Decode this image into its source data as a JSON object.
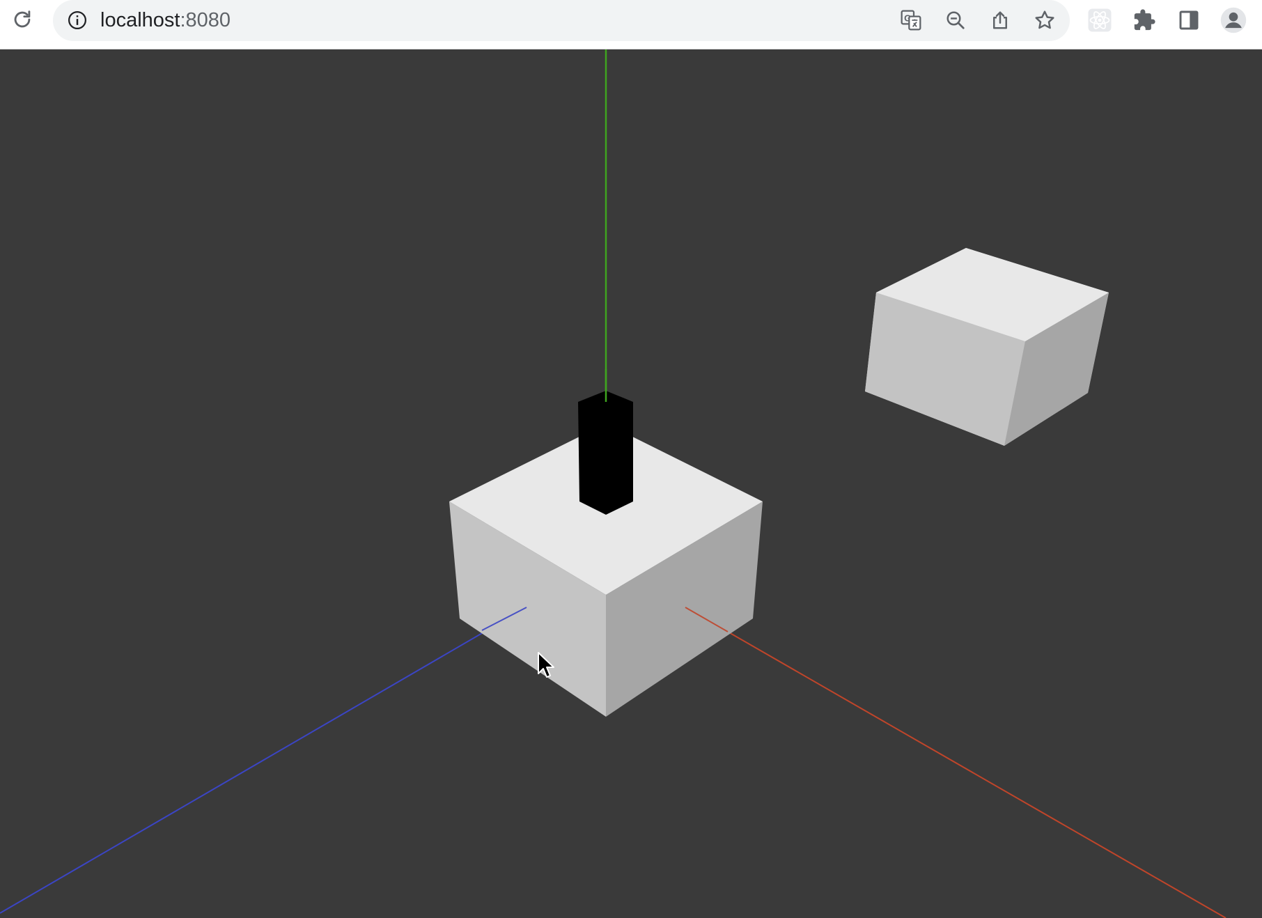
{
  "browser": {
    "url_host": "localhost",
    "url_port": ":8080",
    "icons": {
      "reload": "reload-icon",
      "site_info": "info-icon",
      "translate": "translate-icon",
      "zoom": "zoom-out-icon",
      "share": "share-icon",
      "bookmark": "star-icon",
      "react_devtools": "react-icon",
      "extensions": "puzzle-icon",
      "side_panel": "side-panel-icon",
      "profile": "profile-icon"
    }
  },
  "scene": {
    "background_color": "#3a3a3a",
    "axis_colors": {
      "x": "#c0452a",
      "y": "#3fa41f",
      "z": "#3b45c4"
    },
    "objects": [
      {
        "name": "center-cube",
        "color": "#e8e8e8"
      },
      {
        "name": "floating-cube",
        "color": "#e8e8e8"
      },
      {
        "name": "black-pillar",
        "color": "#000000"
      }
    ]
  }
}
